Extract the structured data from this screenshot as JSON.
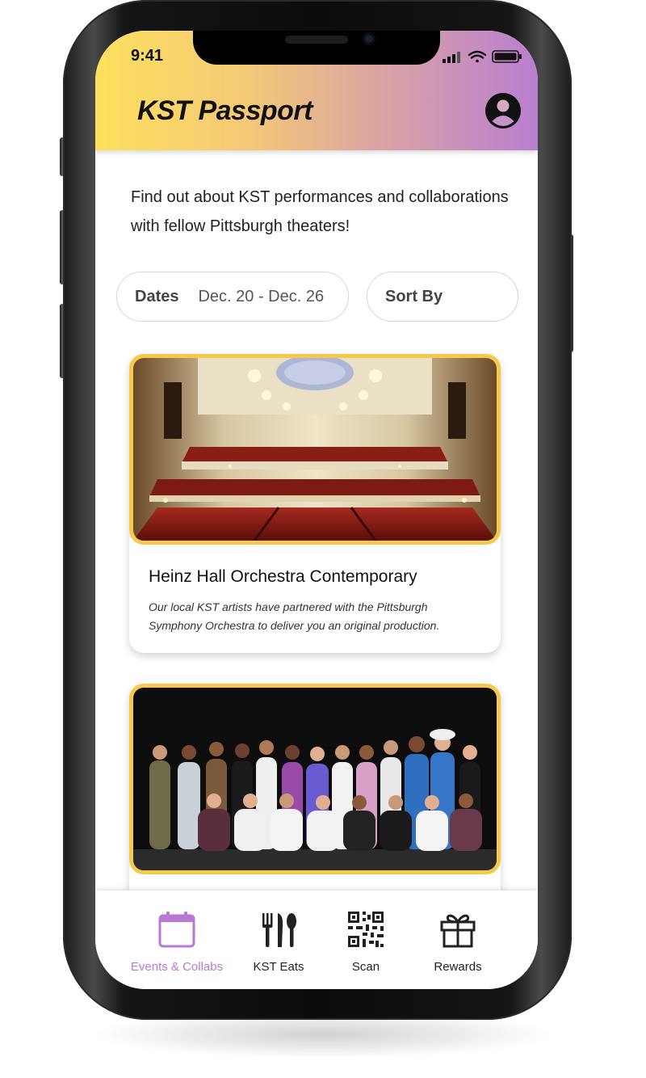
{
  "status_bar": {
    "time": "9:41"
  },
  "header": {
    "title": "KST Passport"
  },
  "intro": {
    "text": "Find out about KST performances and collaborations with fellow Pittsburgh theaters!"
  },
  "filters": {
    "dates_label": "Dates",
    "dates_value": "Dec. 20 - Dec. 26",
    "sort_label": "Sort By"
  },
  "cards": [
    {
      "title": "Heinz Hall Orchestra Contemporary",
      "description": "Our local KST artists have partnered with the Pittsburgh Symphony Orchestra to deliver you an original production."
    },
    {
      "title": "",
      "description": ""
    }
  ],
  "tabs": [
    {
      "label": "Events & Collabs",
      "icon": "calendar-icon",
      "active": true
    },
    {
      "label": "KST Eats",
      "icon": "utensils-icon",
      "active": false
    },
    {
      "label": "Scan",
      "icon": "qr-code-icon",
      "active": false
    },
    {
      "label": "Rewards",
      "icon": "gift-icon",
      "active": false
    }
  ],
  "colors": {
    "header_gradient_start": "#fde15d",
    "header_gradient_end": "#b87fd0",
    "card_border": "#f7c94a",
    "active_tab": "#b879d6"
  }
}
